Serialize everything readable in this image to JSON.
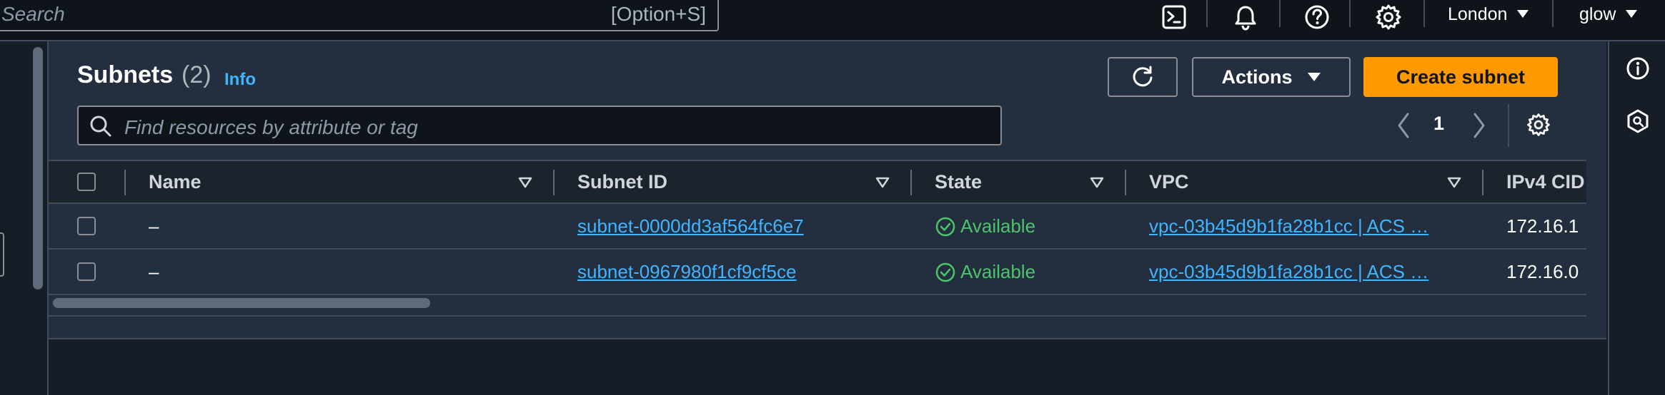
{
  "topbar": {
    "search_placeholder": "Search",
    "search_shortcut": "[Option+S]",
    "region": "London",
    "account": "glow",
    "icons": [
      "cloudshell-icon",
      "bell-icon",
      "help-icon",
      "settings-icon"
    ]
  },
  "panel": {
    "title": "Subnets",
    "count": "(2)",
    "info_label": "Info",
    "actions_label": "Actions",
    "create_label": "Create subnet",
    "filter_placeholder": "Find resources by attribute or tag",
    "page_number": "1"
  },
  "table": {
    "columns": [
      "Name",
      "Subnet ID",
      "State",
      "VPC",
      "IPv4 CID"
    ],
    "rows": [
      {
        "name": "–",
        "subnet_id": "subnet-0000dd3af564fc6e7",
        "state": "Available",
        "vpc": "vpc-03b45d9b1fa28b1cc | ACS …",
        "ipv4": "172.16.1"
      },
      {
        "name": "–",
        "subnet_id": "subnet-0967980f1cf9cf5ce",
        "state": "Available",
        "vpc": "vpc-03b45d9b1fa28b1cc | ACS …",
        "ipv4": "172.16.0"
      }
    ]
  },
  "colors": {
    "accent_orange": "#ff9900",
    "link_blue": "#42b4ff",
    "status_green": "#4fc36c",
    "panel_bg": "#232f3e",
    "nav_bg": "#0f141a"
  }
}
